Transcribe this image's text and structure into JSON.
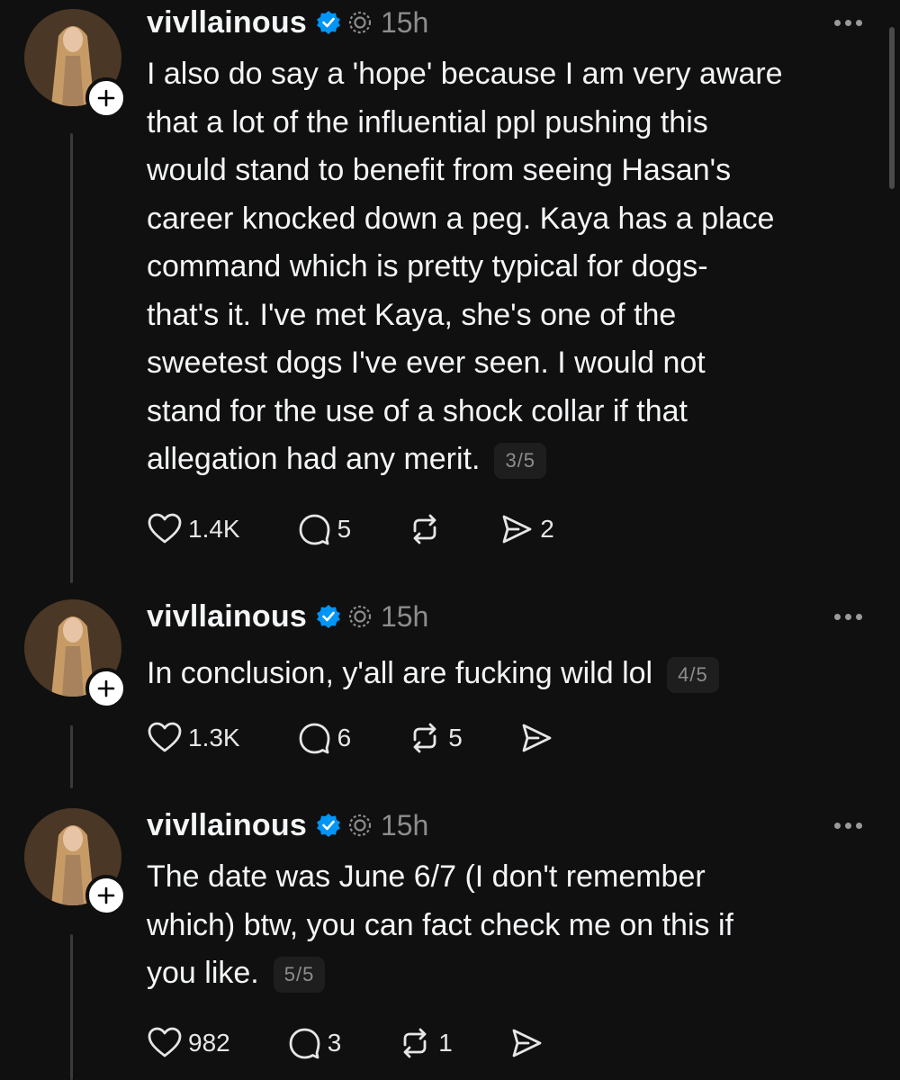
{
  "posts": [
    {
      "username": "vivllainous",
      "time": "15h",
      "lines": [
        "I also do say a 'hope' because I am very aware",
        "that a lot of the influential ppl pushing this",
        "would stand to benefit from seeing Hasan's",
        "career knocked down a peg. Kaya has a place",
        "command which is pretty typical for dogs-",
        "that's it. I've met Kaya, she's one of the",
        "sweetest dogs I've ever seen. I would not",
        "stand for the use of a shock collar if that",
        "allegation had any merit."
      ],
      "counter": "3/5",
      "likes": "1.4K",
      "replies": "5",
      "reposts": "",
      "shares": "2"
    },
    {
      "username": "vivllainous",
      "time": "15h",
      "lines": [
        "In conclusion, y'all are fucking wild lol"
      ],
      "counter": "4/5",
      "likes": "1.3K",
      "replies": "6",
      "reposts": "5",
      "shares": ""
    },
    {
      "username": "vivllainous",
      "time": "15h",
      "lines": [
        "The date was June 6/7 (I don't remember",
        "which) btw, you can fact check me on this if",
        "you like."
      ],
      "counter": "5/5",
      "likes": "982",
      "replies": "3",
      "reposts": "1",
      "shares": ""
    }
  ],
  "colors": {
    "background": "#101010",
    "text": "#f3f5f7",
    "muted": "#8d8d8d",
    "verified": "#0095f6"
  },
  "icons": [
    "verified-badge-icon",
    "thread-ai-icon",
    "more-icon",
    "heart-icon",
    "comment-icon",
    "repost-icon",
    "share-icon",
    "plus-icon"
  ]
}
